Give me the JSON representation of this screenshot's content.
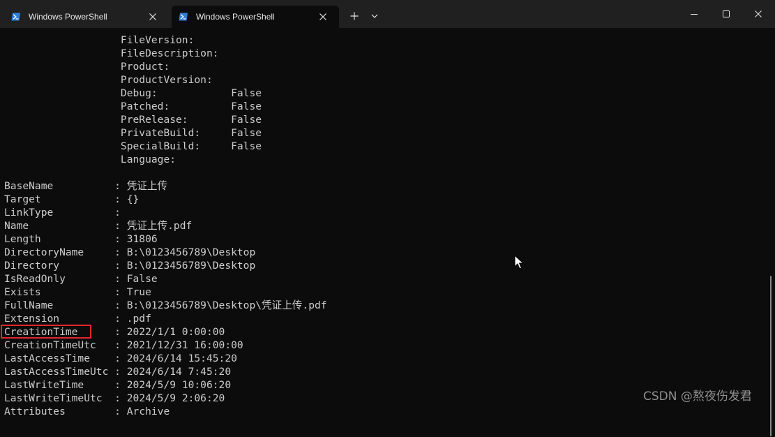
{
  "tabs": [
    {
      "title": "Windows PowerShell",
      "active": false,
      "icon": "powershell-icon"
    },
    {
      "title": "Windows PowerShell",
      "active": true,
      "icon": "powershell-icon"
    }
  ],
  "toolbar": {
    "new_tab_icon": "plus-icon",
    "dropdown_icon": "chevron-down-icon"
  },
  "window_controls": [
    "minimize-icon",
    "maximize-icon",
    "close-icon"
  ],
  "colors": {
    "background": "#0c0c0c",
    "titlebar": "#202020",
    "text": "#cccccc",
    "highlight": "#e3262b",
    "powershell_icon": "#2f7fd6"
  },
  "terminal": {
    "version_info_lines": [
      "                   FileVersion:",
      "                   FileDescription:",
      "                   Product:",
      "                   ProductVersion:",
      "                   Debug:            False",
      "                   Patched:          False",
      "                   PreRelease:       False",
      "                   PrivateBuild:     False",
      "                   SpecialBuild:     False",
      "                   Language:",
      ""
    ],
    "properties": [
      {
        "name": "BaseName",
        "value": "凭证上传"
      },
      {
        "name": "Target",
        "value": "{}"
      },
      {
        "name": "LinkType",
        "value": ""
      },
      {
        "name": "Name",
        "value": "凭证上传.pdf"
      },
      {
        "name": "Length",
        "value": "31806"
      },
      {
        "name": "DirectoryName",
        "value": "B:\\0123456789\\Desktop"
      },
      {
        "name": "Directory",
        "value": "B:\\0123456789\\Desktop"
      },
      {
        "name": "IsReadOnly",
        "value": "False"
      },
      {
        "name": "Exists",
        "value": "True"
      },
      {
        "name": "FullName",
        "value": "B:\\0123456789\\Desktop\\凭证上传.pdf"
      },
      {
        "name": "Extension",
        "value": ".pdf"
      },
      {
        "name": "CreationTime",
        "value": "2022/1/1 0:00:00"
      },
      {
        "name": "CreationTimeUtc",
        "value": "2021/12/31 16:00:00"
      },
      {
        "name": "LastAccessTime",
        "value": "2024/6/14 15:45:20"
      },
      {
        "name": "LastAccessTimeUtc",
        "value": "2024/6/14 7:45:20"
      },
      {
        "name": "LastWriteTime",
        "value": "2024/5/9 10:06:20"
      },
      {
        "name": "LastWriteTimeUtc",
        "value": "2024/5/9 2:06:20"
      },
      {
        "name": "Attributes",
        "value": "Archive"
      }
    ]
  },
  "watermark": "CSDN @熬夜伤发君"
}
